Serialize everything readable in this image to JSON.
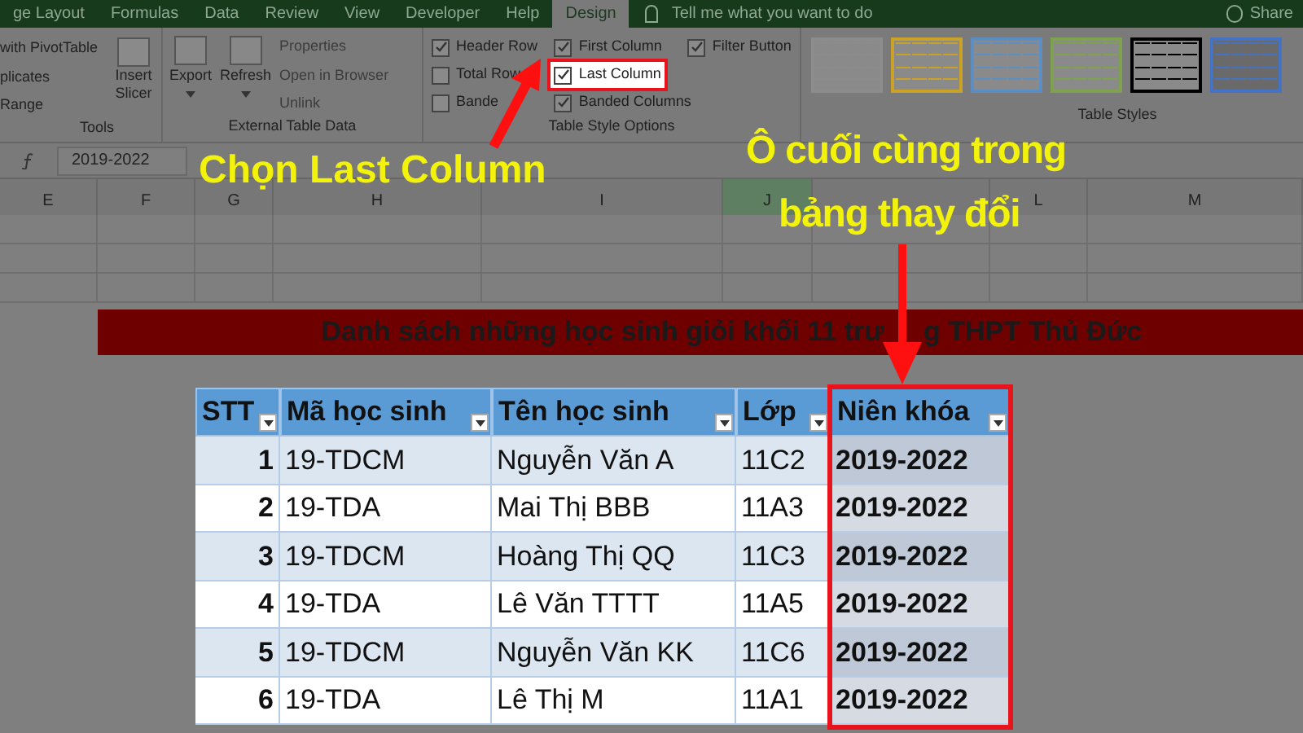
{
  "ribbon_tabs": [
    {
      "label": "ge Layout",
      "selected": false
    },
    {
      "label": "Formulas",
      "selected": false
    },
    {
      "label": "Data",
      "selected": false
    },
    {
      "label": "Review",
      "selected": false
    },
    {
      "label": "View",
      "selected": false
    },
    {
      "label": "Developer",
      "selected": false
    },
    {
      "label": "Help",
      "selected": false
    },
    {
      "label": "Design",
      "selected": true
    }
  ],
  "tell_me": "Tell me what you want to do",
  "share": "Share",
  "tools_group": {
    "items": [
      "with PivotTable",
      "plicates",
      "Range"
    ],
    "label": "Tools"
  },
  "insert_slicer": "Insert Slicer",
  "external_group": {
    "buttons": [
      "Export",
      "Refresh"
    ],
    "items": [
      {
        "label": "Properties",
        "disabled": true
      },
      {
        "label": "Open in Browser",
        "disabled": true
      },
      {
        "label": "Unlink",
        "disabled": true
      }
    ],
    "label": "External Table Data"
  },
  "style_options": {
    "columns": [
      [
        {
          "label": "Header Row",
          "checked": true,
          "highlighted": false
        },
        {
          "label": "Total Row",
          "checked": false,
          "highlighted": false
        },
        {
          "label": "Bande",
          "checked": false,
          "highlighted": false
        }
      ],
      [
        {
          "label": "First Column",
          "checked": true,
          "highlighted": false
        },
        {
          "label": "Last Column",
          "checked": true,
          "highlighted": true
        },
        {
          "label": "Banded Columns",
          "checked": true,
          "highlighted": false
        }
      ],
      [
        {
          "label": "Filter Button",
          "checked": true,
          "highlighted": false
        }
      ]
    ],
    "label": "Table Style Options"
  },
  "table_styles": {
    "swatches": [
      {
        "color": "#8c8c8c",
        "selected": false
      },
      {
        "color": "#c9a227",
        "selected": false
      },
      {
        "color": "#5b8fc4",
        "selected": false
      },
      {
        "color": "#7fa34c",
        "selected": false
      },
      {
        "color": "#000000",
        "selected": false
      },
      {
        "color": "#4472c4",
        "selected": true
      }
    ],
    "label": "Table Styles"
  },
  "formula_bar": {
    "value": "2019-2022"
  },
  "sheet_columns": [
    {
      "label": "E",
      "selected": false
    },
    {
      "label": "F",
      "selected": false
    },
    {
      "label": "G",
      "selected": false
    },
    {
      "label": "H",
      "selected": false
    },
    {
      "label": "I",
      "selected": false
    },
    {
      "label": "J",
      "selected": true
    },
    {
      "selected": false
    },
    {
      "label": "L",
      "selected": false
    },
    {
      "label": "M",
      "selected": false
    }
  ],
  "title": [
    "Danh sách những học sinh giỏi khối 11 trư",
    "g THPT Thủ Đức"
  ],
  "table": {
    "columns": [
      "STT",
      "Mã học sinh",
      "Tên học sinh",
      "Lớp",
      "Niên khóa"
    ],
    "rows": [
      [
        "1",
        "19-TDCM",
        "Nguyễn Văn A",
        "11C2",
        "2019-2022"
      ],
      [
        "2",
        "19-TDA",
        "Mai Thị BBB",
        "11A3",
        "2019-2022"
      ],
      [
        "3",
        "19-TDCM",
        "Hoàng Thị QQ",
        "11C3",
        "2019-2022"
      ],
      [
        "4",
        "19-TDA",
        "Lê Văn TTTT",
        "11A5",
        "2019-2022"
      ],
      [
        "5",
        "19-TDCM",
        "Nguyễn Văn KK",
        "11C6",
        "2019-2022"
      ],
      [
        "6",
        "19-TDA",
        "Lê Thị M",
        "11A1",
        "2019-2022"
      ]
    ]
  },
  "annotations": [
    "Chọn Last Column",
    "Ô cuối cùng trong",
    "bảng thay đổi"
  ]
}
